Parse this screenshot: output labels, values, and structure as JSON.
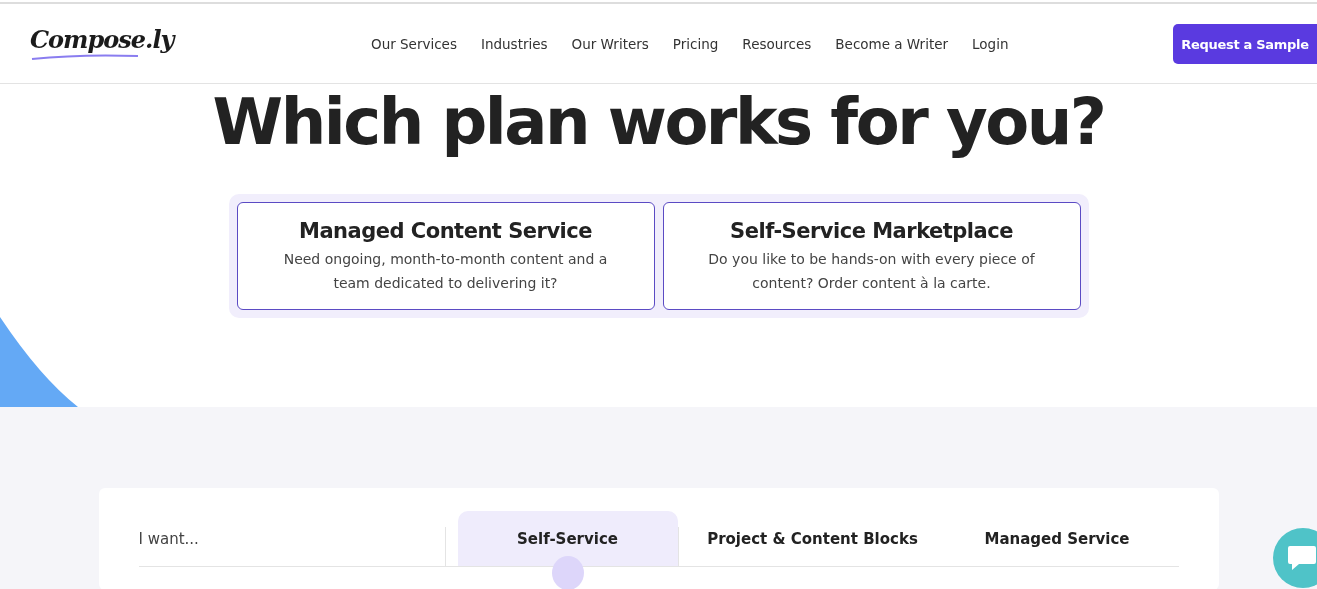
{
  "header": {
    "logo": "Compose.ly",
    "nav": [
      "Our Services",
      "Industries",
      "Our Writers",
      "Pricing",
      "Resources",
      "Become a Writer",
      "Login"
    ],
    "cta": "Request a Sample"
  },
  "hero": {
    "title": "Which plan works for you?",
    "plans": [
      {
        "title": "Managed Content Service",
        "description": "Need ongoing, month-to-month content and a team dedicated to delivering it?"
      },
      {
        "title": "Self-Service Marketplace",
        "description": "Do you like to be hands-on with every piece of content? Order content à la carte."
      }
    ]
  },
  "comparison": {
    "columns": [
      {
        "label": "I want...",
        "selected": false
      },
      {
        "label": "Self-Service",
        "selected": true
      },
      {
        "label": "Project & Content Blocks",
        "selected": false
      },
      {
        "label": "Managed Service",
        "selected": false
      }
    ]
  }
}
